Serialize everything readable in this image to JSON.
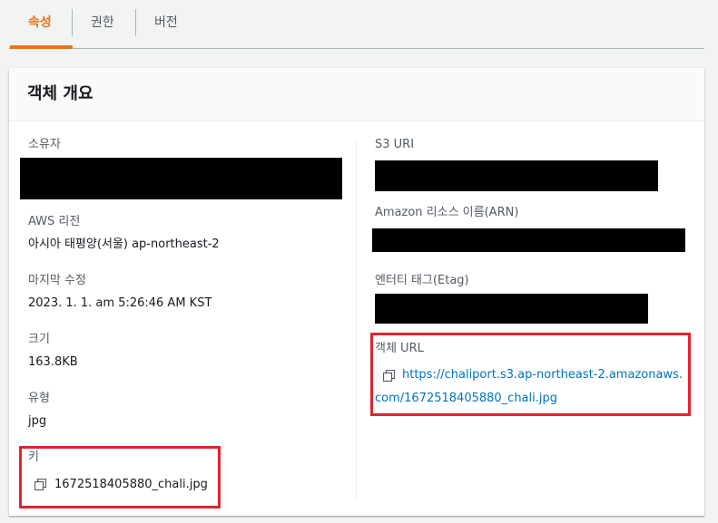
{
  "tabs": [
    {
      "label": "속성",
      "active": true
    },
    {
      "label": "권한"
    },
    {
      "label": "버전"
    }
  ],
  "panel": {
    "title": "객체 개요"
  },
  "left": {
    "owner_label": "소유자",
    "region_label": "AWS 리전",
    "region_value": "아시아 태평양(서울) ap-northeast-2",
    "modified_label": "마지막 수정",
    "modified_value": "2023. 1. 1. am 5:26:46 AM KST",
    "size_label": "크기",
    "size_value": "163.8KB",
    "type_label": "유형",
    "type_value": "jpg",
    "key_label": "키",
    "key_value": "1672518405880_chali.jpg"
  },
  "right": {
    "s3uri_label": "S3 URI",
    "arn_label": "Amazon 리소스 이름(ARN)",
    "etag_label": "엔터티 태그(Etag)",
    "url_label": "객체 URL",
    "url_value": "https://chaliport.s3.ap-northeast-2.amazonaws.com/1672518405880_chali.jpg"
  },
  "colors": {
    "accent": "#ec7211",
    "link": "#0073bb",
    "highlight": "#e0242f"
  }
}
